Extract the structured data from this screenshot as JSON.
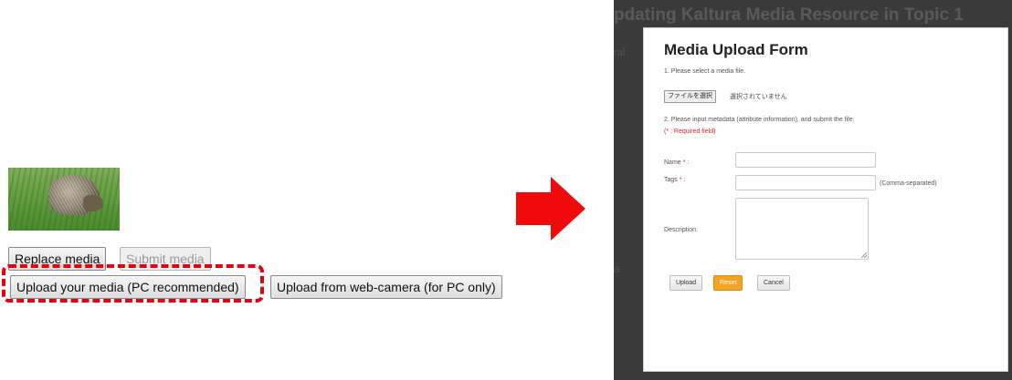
{
  "left": {
    "replace_label": "Replace media",
    "submit_label": "Submit media",
    "upload_label": "Upload your media (PC recommended)",
    "webcam_label": "Upload from web-camera (for PC only)"
  },
  "colors": {
    "highlight": "#e4000f",
    "arrow": "#f00a0a",
    "primary_button": "#f5a320"
  },
  "screenshot": {
    "bg_title": "pdating Kaltura Media Resource in Topic 1",
    "bg_side_text": "ral",
    "bg_side_text2": "a",
    "modal": {
      "title": "Media Upload Form",
      "step1": "1. Please select a media file.",
      "file_button": "ファイルを選択",
      "file_none": "選択されていません",
      "step2": "2. Please input metadata (attribute information), and submit the file.",
      "required_note": "(* : Required field)",
      "name_label": "Name",
      "tags_label": "Tags",
      "req_mark": "* :",
      "tags_hint": "(Comma-separated)",
      "description_label": "Description:",
      "upload_label": "Upload",
      "reset_label": "Reset",
      "cancel_label": "Cancel"
    }
  }
}
